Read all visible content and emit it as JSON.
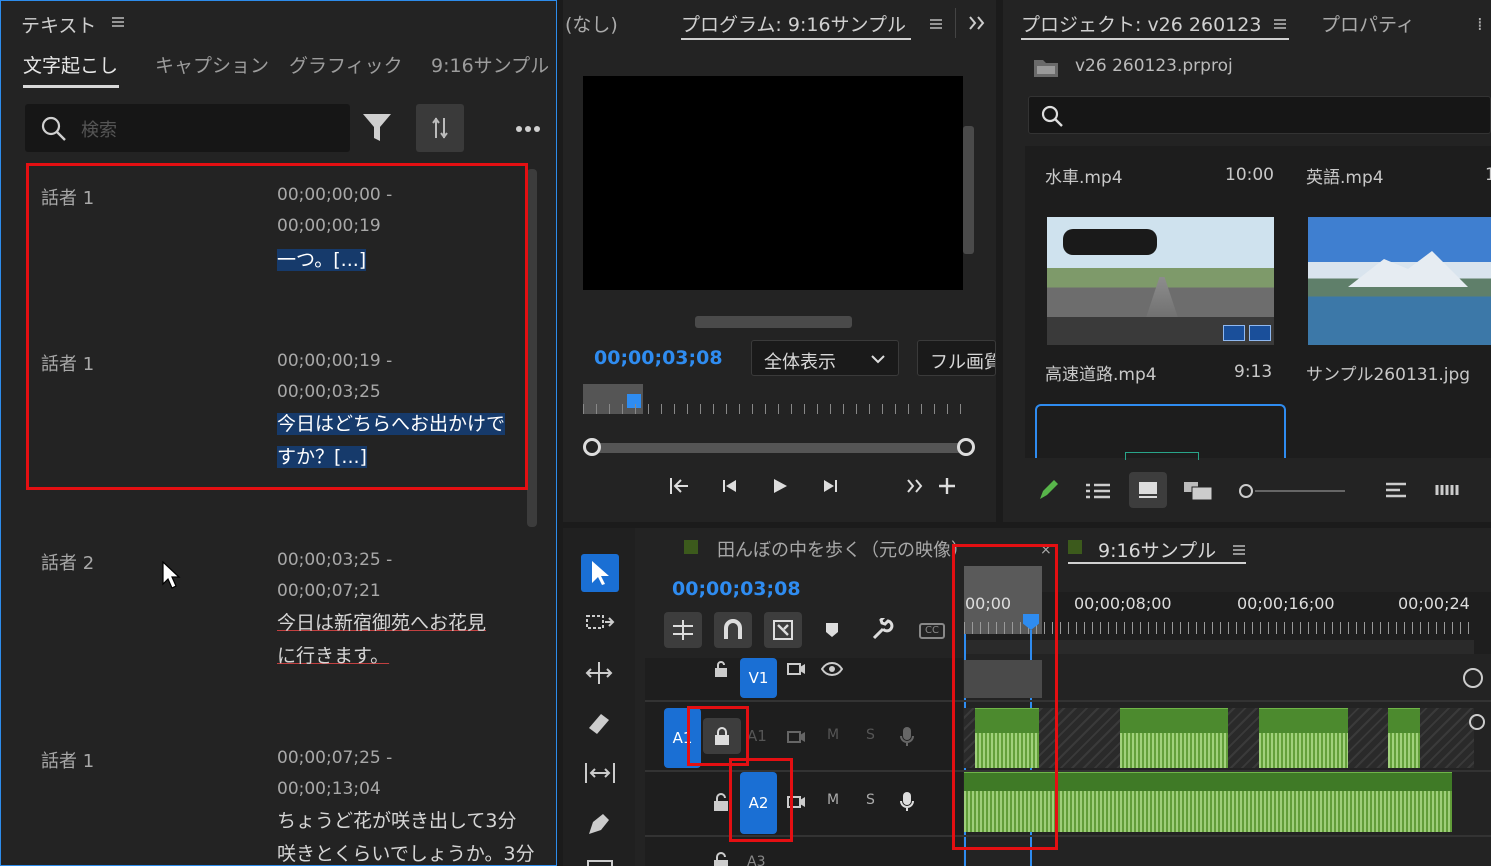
{
  "text_panel": {
    "title": "テキスト",
    "tabs": [
      "文字起こし",
      "キャプション",
      "グラフィック",
      "9:16サンプル"
    ],
    "search_placeholder": "検索",
    "entries": [
      {
        "speaker": "話者 1",
        "tc_start": "00;00;00;00 -",
        "tc_end": "00;00;00;19",
        "lines": [
          "一つ。[...]"
        ]
      },
      {
        "speaker": "話者 1",
        "tc_start": "00;00;00;19 -",
        "tc_end": "00;00;03;25",
        "lines": [
          "今日はどちらへお出かけで",
          "すか？[...]"
        ]
      },
      {
        "speaker": "話者 2",
        "tc_start": "00;00;03;25 -",
        "tc_end": "00;00;07;21",
        "lines": [
          "今日は新宿御苑へお花見",
          "に行きます。"
        ]
      },
      {
        "speaker": "話者 1",
        "tc_start": "00;00;07;25 -",
        "tc_end": "00;00;13;04",
        "lines": [
          "ちょうど花が咲き出して3分",
          "咲きとくらいでしょうか。3分"
        ]
      }
    ]
  },
  "program": {
    "source_label": "(なし)",
    "title": "プログラム: 9:16サンプル",
    "timecode": "00;00;03;08",
    "zoom": "全体表示",
    "quality": "フル画質"
  },
  "project": {
    "title": "プロジェクト: v26 260123",
    "properties_tab": "プロパティ",
    "file": "v26 260123.prproj",
    "items": [
      {
        "name": "水車.mp4",
        "duration": "10:00"
      },
      {
        "name": "英語.mp4",
        "duration": "1"
      },
      {
        "name": "高速道路.mp4",
        "duration": "9:13"
      },
      {
        "name": "サンプル260131.jpg",
        "duration": ""
      }
    ]
  },
  "timeline": {
    "tab1": "田んぼの中を歩く（元の映像）",
    "tab2": "9:16サンプル",
    "timecode": "00;00;03;08",
    "ruler": [
      "00;00",
      "00;00;08;00",
      "00;00;16;00",
      "00;00;24"
    ],
    "tracks": {
      "v1": "V1",
      "a1_target": "A1",
      "a1": "A1",
      "a2": "A2",
      "a3": "A3",
      "m": "M",
      "s": "S"
    }
  },
  "colors": {
    "accent": "#2f8cf0",
    "highlight_box": "#e40f12",
    "clip_green": "#4c8a2e"
  }
}
